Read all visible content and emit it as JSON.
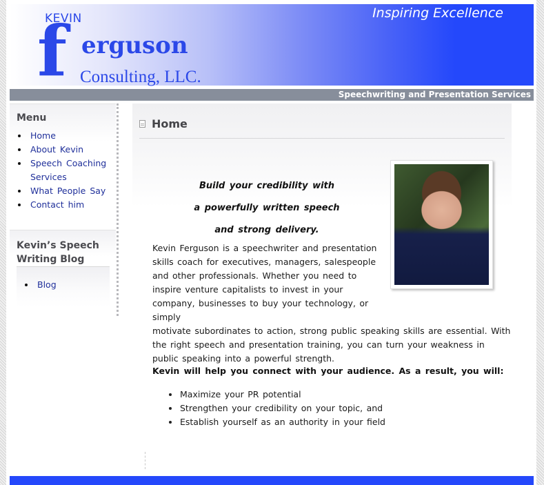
{
  "header": {
    "logo": {
      "kevin": "KEVIN",
      "f": "f",
      "erguson": "erguson",
      "consulting": "Consulting, LLC."
    },
    "tagline": "Inspiring Excellence",
    "subtitle": "Speechwriting and Presentation Services",
    "colors": {
      "brand_blue": "#2448fb",
      "subbar_gray": "#878e9b",
      "link_blue": "#1f2f9a"
    }
  },
  "sidebar": {
    "menu": {
      "title": "Menu",
      "items": [
        {
          "label": "Home"
        },
        {
          "label": "About Kevin"
        },
        {
          "label": "Speech Coaching Services"
        },
        {
          "label": "What People Say"
        },
        {
          "label": "Contact him"
        }
      ]
    },
    "blog": {
      "title": "Kevin’s Speech Writing Blog",
      "items": [
        {
          "label": "Blog"
        }
      ]
    }
  },
  "main": {
    "page_icon": "document-icon",
    "title": "Home",
    "headline": [
      "Build your credibility with",
      "a powerfully written speech",
      "and strong delivery."
    ],
    "photo_alt": "Photo of Kevin Ferguson",
    "intro_narrow": "Kevin Ferguson is a speechwriter and presentation skills coach for executives, managers, salespeople and other professionals. Whether you need to inspire venture capitalists to invest in your company, businesses to buy your technology, or simply",
    "intro_wide": "motivate subordinates to action, strong public speaking skills are essential. With the right speech and presentation training, you can turn your weakness in public speaking into a powerful strength.",
    "help_line": "Kevin will help you connect with your audience. As a result, you will:",
    "benefits": [
      "Maximize your PR potential",
      "Strengthen your credibility on your topic, and",
      "Establish yourself as an authority in your field"
    ]
  }
}
